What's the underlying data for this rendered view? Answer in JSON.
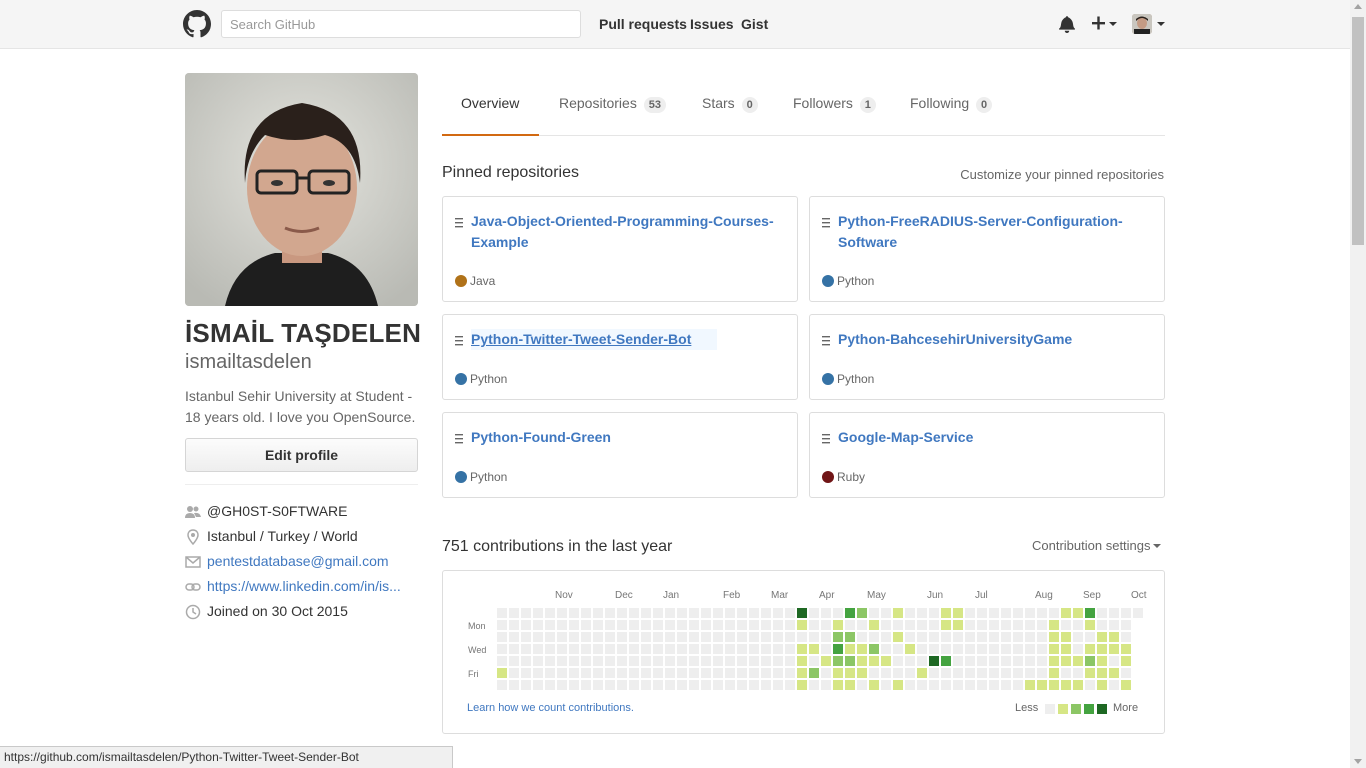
{
  "header": {
    "search_placeholder": "Search GitHub",
    "nav": [
      "Pull requests",
      "Issues",
      "Gist"
    ]
  },
  "profile": {
    "fullname": "İSMAİL TAŞDELEN",
    "username": "ismailtasdelen",
    "bio": "Istanbul Sehir University at Student - 18 years old. I love you OpenSource.",
    "edit_label": "Edit profile",
    "details": {
      "org": "@GH0ST-S0FTWARE",
      "location": "Istanbul / Turkey / World",
      "email": "pentestdatabase@gmail.com",
      "url": "https://www.linkedin.com/in/is...",
      "joined": "Joined on 30 Oct 2015"
    }
  },
  "tabs": [
    {
      "label": "Overview",
      "count": ""
    },
    {
      "label": "Repositories",
      "count": "53"
    },
    {
      "label": "Stars",
      "count": "0"
    },
    {
      "label": "Followers",
      "count": "1"
    },
    {
      "label": "Following",
      "count": "0"
    }
  ],
  "pinned": {
    "title": "Pinned repositories",
    "customize": "Customize your pinned repositories",
    "repos": [
      {
        "name": "Java-Object-Oriented-Programming-Courses-Example",
        "lang": "Java",
        "color": "#b07219"
      },
      {
        "name": "Python-FreeRADIUS-Server-Configuration-Software",
        "lang": "Python",
        "color": "#3572A5"
      },
      {
        "name": "Python-Twitter-Tweet-Sender-Bot",
        "lang": "Python",
        "color": "#3572A5"
      },
      {
        "name": "Python-BahcesehirUniversityGame",
        "lang": "Python",
        "color": "#3572A5"
      },
      {
        "name": "Python-Found-Green",
        "lang": "Python",
        "color": "#3572A5"
      },
      {
        "name": "Google-Map-Service",
        "lang": "Ruby",
        "color": "#701516"
      }
    ]
  },
  "contributions": {
    "title": "751 contributions in the last year",
    "settings": "Contribution settings",
    "months": [
      "Nov",
      "Dec",
      "Jan",
      "Feb",
      "Mar",
      "Apr",
      "May",
      "Jun",
      "Jul",
      "Aug",
      "Sep",
      "Oct"
    ],
    "days": [
      "Mon",
      "Wed",
      "Fri"
    ],
    "learn": "Learn how we count contributions.",
    "less": "Less",
    "more": "More",
    "colors": [
      "#eeeeee",
      "#d6e685",
      "#8cc665",
      "#44a340",
      "#1e6823"
    ]
  },
  "statusbar": "https://github.com/ismailtasdelen/Python-Twitter-Tweet-Sender-Bot"
}
